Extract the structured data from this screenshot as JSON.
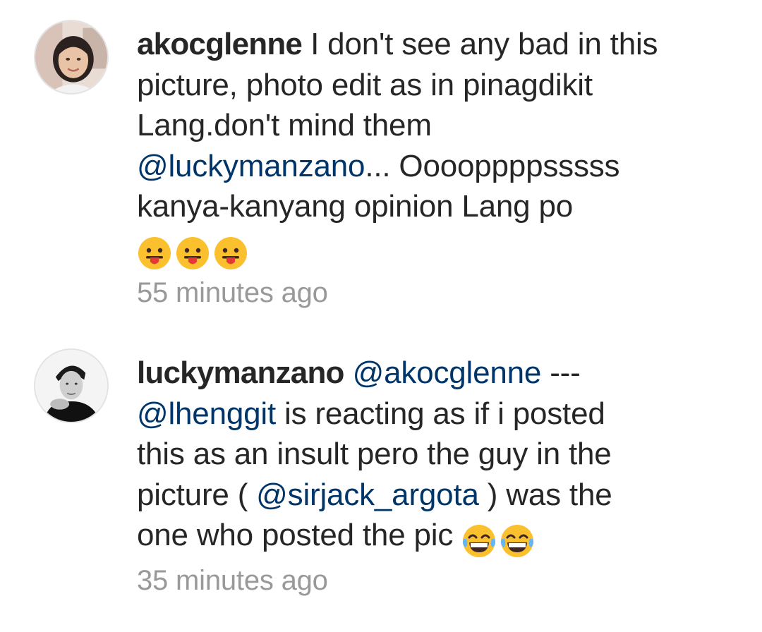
{
  "comments": [
    {
      "username": "akocglenne",
      "lines": [
        "I don't see any bad in this",
        "picture, photo edit as in pinagdikit",
        "Lang.don't mind them"
      ],
      "mention_1": "@luckymanzano",
      "after_mention_1": "... Ooooppppsssss",
      "line_5": "kanya-kanyang opinion Lang po",
      "emoji": [
        "tongue-face",
        "tongue-face",
        "tongue-face"
      ],
      "timestamp": "55 minutes ago"
    },
    {
      "username": "luckymanzano",
      "mention_1": "@akocglenne",
      "after_mention_1": " ---",
      "mention_2": "@lhenggit",
      "after_mention_2": " is reacting as if i posted",
      "line_3": "this as an insult pero the guy in the",
      "line_4_pre": "picture ( ",
      "mention_3": "@sirjack_argota",
      "line_4_post": " ) was the",
      "line_5": "one who posted the pic ",
      "emoji": [
        "tears-of-joy",
        "tears-of-joy"
      ],
      "timestamp": "35 minutes ago"
    }
  ],
  "colors": {
    "text": "#262626",
    "mention": "#003569",
    "timestamp": "#999999",
    "emoji_yellow": "#FBC02D"
  }
}
